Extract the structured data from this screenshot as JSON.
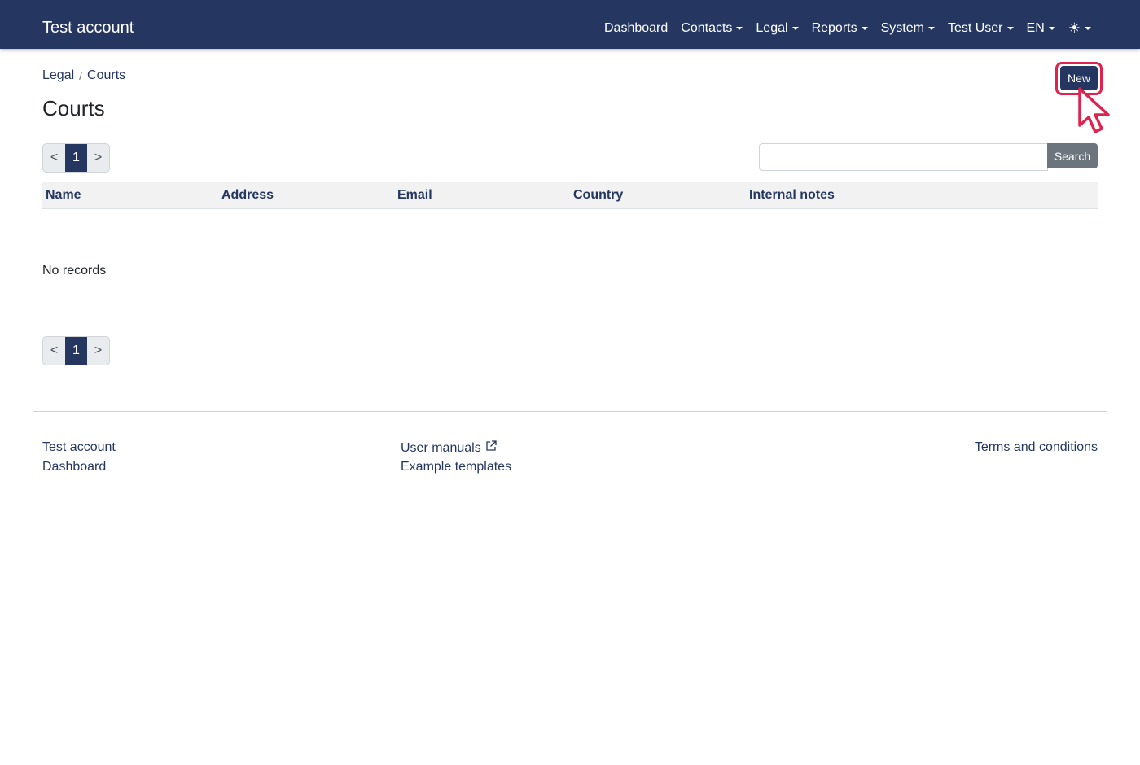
{
  "navbar": {
    "brand": "Test account",
    "items": [
      {
        "label": "Dashboard",
        "dropdown": false
      },
      {
        "label": "Contacts",
        "dropdown": true
      },
      {
        "label": "Legal",
        "dropdown": true
      },
      {
        "label": "Reports",
        "dropdown": true
      },
      {
        "label": "System",
        "dropdown": true
      },
      {
        "label": "Test User",
        "dropdown": true
      },
      {
        "label": "EN",
        "dropdown": true
      }
    ],
    "theme_icon": "sun-icon",
    "theme_glyph": "☀"
  },
  "breadcrumb": {
    "items": [
      "Legal",
      "Courts"
    ],
    "separator": "/"
  },
  "page": {
    "title": "Courts",
    "new_button": "New"
  },
  "pagination": {
    "prev": "<",
    "current": "1",
    "next": ">"
  },
  "search": {
    "value": "",
    "placeholder": "",
    "button": "Search"
  },
  "table": {
    "columns": [
      "Name",
      "Address",
      "Email",
      "Country",
      "Internal notes"
    ],
    "rows": [],
    "empty_text": "No records"
  },
  "footer": {
    "col1": [
      "Test account",
      "Dashboard"
    ],
    "col2": [
      "User manuals",
      "Example templates"
    ],
    "col3": [
      "Terms and conditions"
    ],
    "external_icon": "external-link-icon"
  },
  "colors": {
    "primary": "#253760",
    "highlight": "#e0234e",
    "secondary": "#6c757d"
  }
}
